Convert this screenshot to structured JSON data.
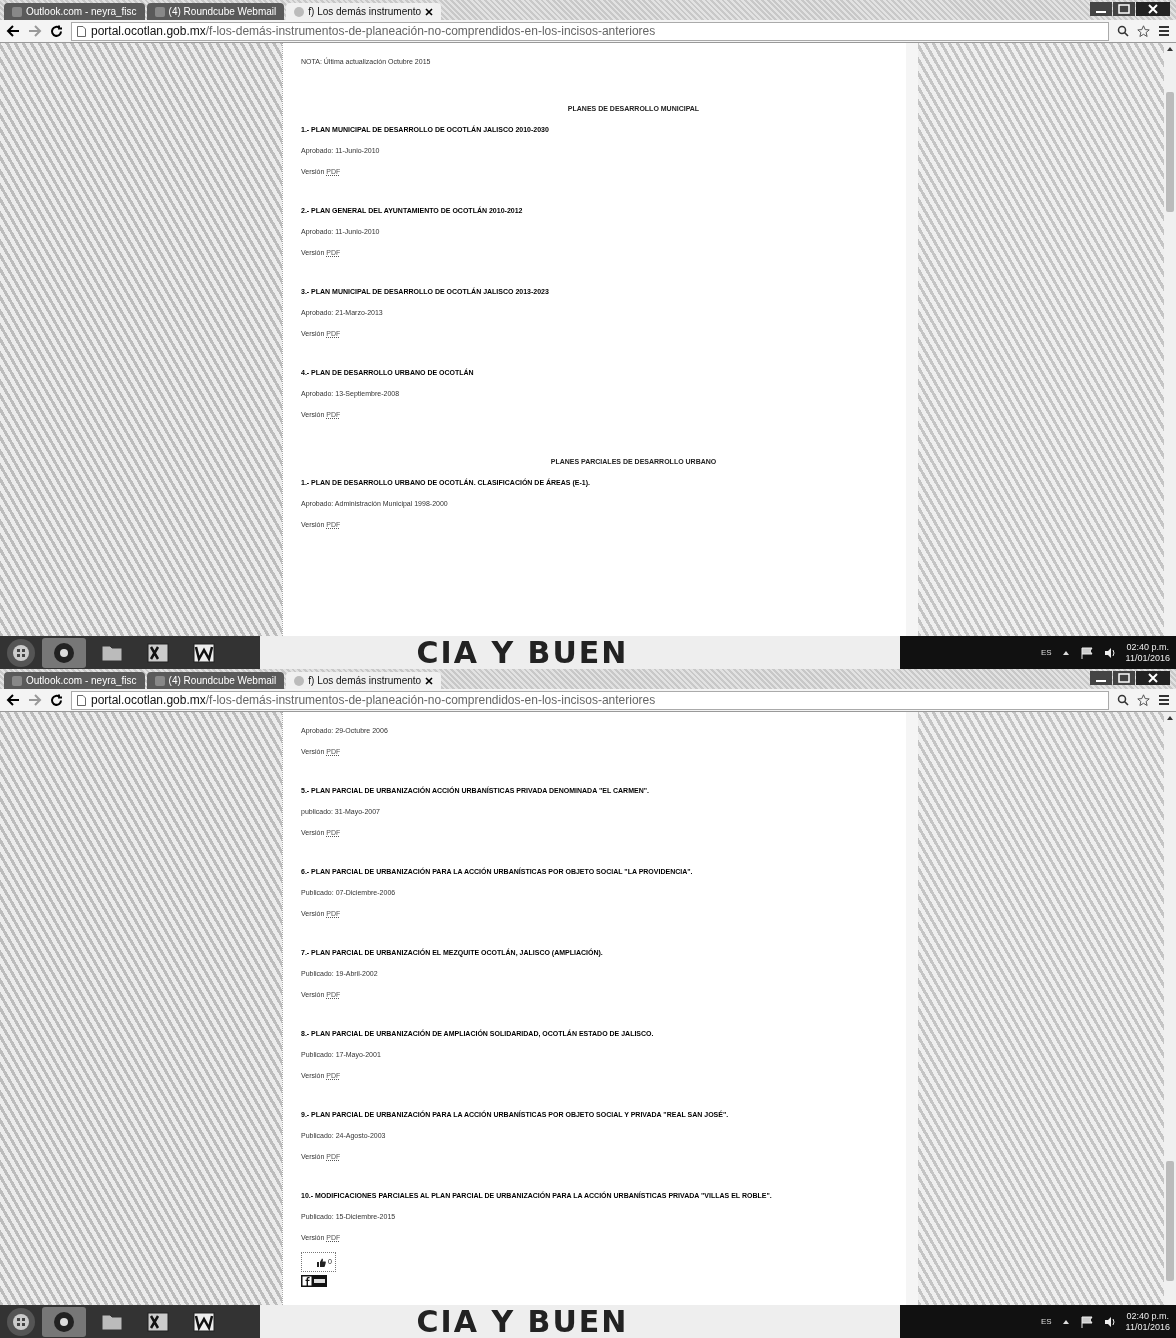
{
  "screens": [
    {
      "tabs": [
        {
          "label": "Outlook.com - neyra_fisc",
          "selected": false
        },
        {
          "label": "(4) Roundcube Webmail",
          "selected": false
        },
        {
          "label": "f) Los demás instrumento",
          "selected": true
        }
      ],
      "address": {
        "host": "portal.ocotlan.gob.mx",
        "path": "/f-los-demás-instrumentos-de-planeación-no-comprendidos-en-los-incisos-anteriores"
      },
      "content": [
        {
          "kind": "note",
          "text": "NOTA: Última actualización Octubre 2015"
        },
        {
          "kind": "heading",
          "text": "PLANES DE DESARROLLO MUNICIPAL"
        },
        {
          "kind": "title",
          "text": "1.- PLAN MUNICIPAL DE DESARROLLO DE OCOTLÁN JALISCO 2010-2030"
        },
        {
          "kind": "line",
          "text": "Aprobado: 11-Junio-2010"
        },
        {
          "kind": "version",
          "text": "Versión",
          "link": "PDF"
        },
        {
          "kind": "title",
          "text": "2.- PLAN GENERAL DEL AYUNTAMIENTO DE OCOTLÁN 2010-2012"
        },
        {
          "kind": "line",
          "text": "Aprobado: 11-Junio-2010"
        },
        {
          "kind": "version",
          "text": "Versión",
          "link": "PDF"
        },
        {
          "kind": "title",
          "text": "3.- PLAN MUNICIPAL DE DESARROLLO DE OCOTLÁN JALISCO 2013-2023"
        },
        {
          "kind": "line",
          "text": "Aprobado: 21-Marzo-2013"
        },
        {
          "kind": "version",
          "text": "Versión",
          "link": "PDF"
        },
        {
          "kind": "title",
          "text": "4.- PLAN DE DESARROLLO URBANO DE OCOTLÁN"
        },
        {
          "kind": "line",
          "text": "Aprobado: 13-Septiembre-2008"
        },
        {
          "kind": "version",
          "text": "Versión",
          "link": "PDF"
        },
        {
          "kind": "heading",
          "text": "PLANES PARCIALES DE DESARROLLO URBANO"
        },
        {
          "kind": "title",
          "text": "1.- PLAN DE DESARROLLO URBANO DE OCOTLÁN. CLASIFICACIÓN DE ÁREAS (E-1)."
        },
        {
          "kind": "line",
          "text": "Aprobado: Administración Municipal 1998-2000"
        },
        {
          "kind": "version",
          "text": "Versión",
          "link": "PDF"
        }
      ],
      "wallpaper_text": "CIA Y BUEN",
      "tray": {
        "language": "ES",
        "time": "02:40 p.m.",
        "date": "11/01/2016"
      }
    },
    {
      "tabs": [
        {
          "label": "Outlook.com - neyra_fisc",
          "selected": false
        },
        {
          "label": "(4) Roundcube Webmail",
          "selected": false
        },
        {
          "label": "f) Los demás instrumento",
          "selected": true
        }
      ],
      "address": {
        "host": "portal.ocotlan.gob.mx",
        "path": "/f-los-demás-instrumentos-de-planeación-no-comprendidos-en-los-incisos-anteriores"
      },
      "content": [
        {
          "kind": "line",
          "text": "Aprobado: 29-Octubre 2006"
        },
        {
          "kind": "version",
          "text": "Versión",
          "link": "PDF"
        },
        {
          "kind": "title",
          "text": "5.- PLAN PARCIAL DE URBANIZACIÓN ACCIÓN URBANÍSTICAS PRIVADA DENOMINADA \"EL CARMEN\"."
        },
        {
          "kind": "line",
          "text": "publicado: 31-Mayo-2007"
        },
        {
          "kind": "version",
          "text": "Versión",
          "link": "PDF"
        },
        {
          "kind": "title",
          "text": "6.- PLAN PARCIAL DE URBANIZACIÓN PARA LA ACCIÓN URBANÍSTICAS POR OBJETO SOCIAL \"LA PROVIDENCIA\"."
        },
        {
          "kind": "line",
          "text": "Publicado: 07-Diciembre-2006"
        },
        {
          "kind": "version",
          "text": "Versión",
          "link": "PDF"
        },
        {
          "kind": "title",
          "text": "7.- PLAN PARCIAL DE URBANIZACIÓN EL MEZQUITE OCOTLÁN, JALISCO (AMPLIACIÓN)."
        },
        {
          "kind": "line",
          "text": "Publicado: 19-Abril-2002"
        },
        {
          "kind": "version",
          "text": "Versión",
          "link": "PDF"
        },
        {
          "kind": "title",
          "text": "8.- PLAN PARCIAL DE URBANIZACIÓN DE AMPLIACIÓN SOLIDARIDAD, OCOTLÁN ESTADO DE JALISCO."
        },
        {
          "kind": "line",
          "text": "Publicado: 17-Mayo-2001"
        },
        {
          "kind": "version",
          "text": "Versión",
          "link": "PDF"
        },
        {
          "kind": "title",
          "text": "9.- PLAN PARCIAL DE URBANIZACIÓN PARA LA ACCIÓN URBANÍSTICAS POR OBJETO SOCIAL Y PRIVADA \"REAL SAN JOSÉ\"."
        },
        {
          "kind": "line",
          "text": "Publicado: 24-Agosto-2003"
        },
        {
          "kind": "version",
          "text": "Versión",
          "link": "PDF"
        },
        {
          "kind": "title",
          "text": "10.- MODIFICACIONES PARCIALES AL PLAN PARCIAL DE URBANIZACIÓN PARA LA ACCIÓN URBANÍSTICAS PRIVADA \"VILLAS EL ROBLE\"."
        },
        {
          "kind": "line",
          "text": "Publicado: 15-Diciembre-2015"
        },
        {
          "kind": "version",
          "text": "Versión",
          "link": "PDF"
        },
        {
          "kind": "like",
          "count": "0"
        }
      ],
      "wallpaper_text": "CIA Y BUEN",
      "tray": {
        "language": "ES",
        "time": "02:40 p.m.",
        "date": "11/01/2016"
      }
    }
  ]
}
